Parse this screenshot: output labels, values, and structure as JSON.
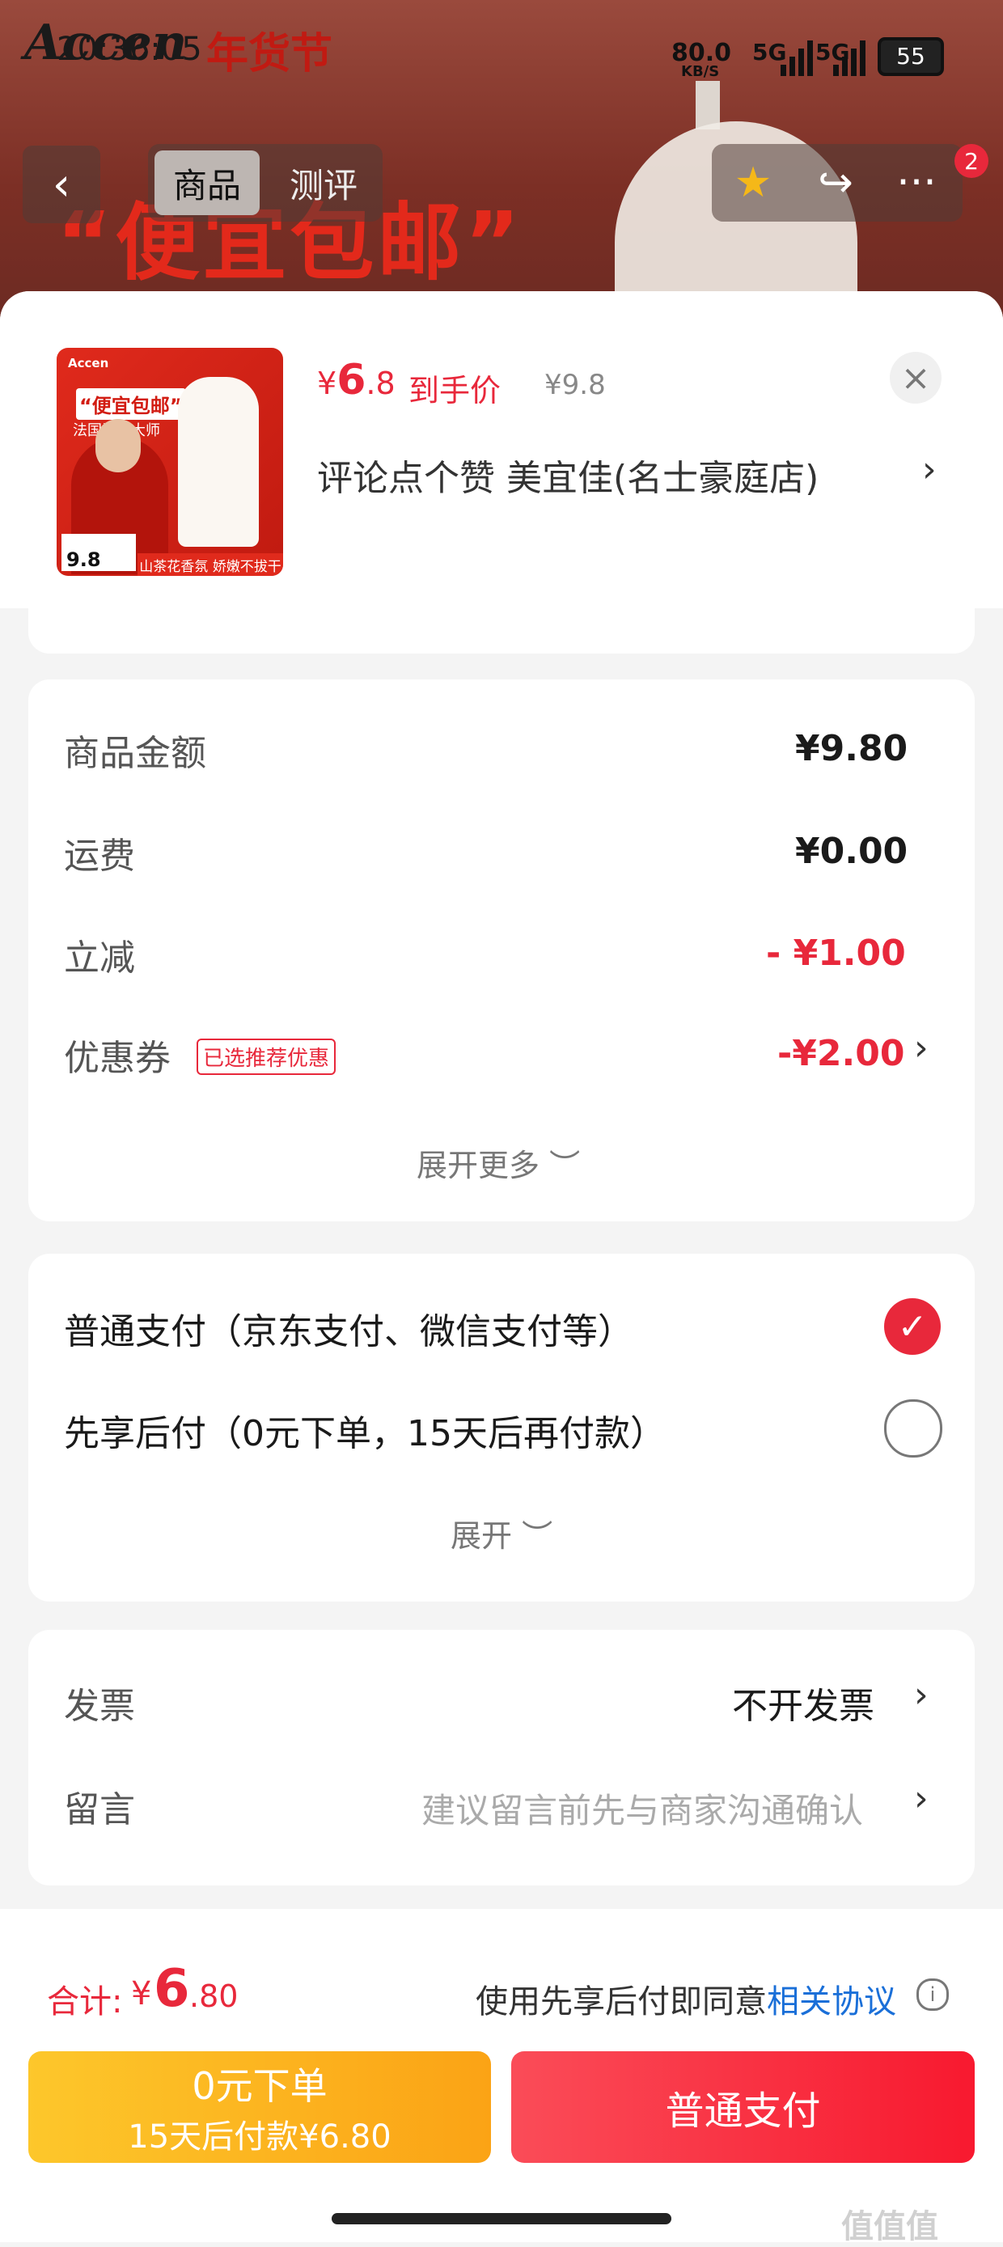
{
  "background": {
    "brand": "Accen",
    "festival": "年货节",
    "promo": "“便宜包邮”"
  },
  "status_bar": {
    "time": "20:36:05",
    "speed": "80.0",
    "speed_unit": "KB/S",
    "net1": "5G",
    "net2": "5G",
    "battery": "55"
  },
  "nav": {
    "back": "‹",
    "tab_goods": "商品",
    "tab_review": "测评",
    "badge_count": "2",
    "star": "★",
    "share": "↪",
    "more": "···"
  },
  "product": {
    "thumb_brand": "Accen",
    "thumb_slogan": "“便宜包邮”",
    "thumb_sub": "法国调香大师",
    "thumb_price": "9.8",
    "thumb_strip": "山茶花香氛 娇嫩不拔干",
    "deal_currency": "¥",
    "deal_int": "6",
    "deal_dec": ".8",
    "deal_label": "到手价",
    "orig_price": "¥9.8",
    "shop_line": "评论点个赞  美宜佳(名士豪庭店)",
    "close": "×"
  },
  "amount": {
    "goods_label": "商品金额",
    "goods_val": "¥9.80",
    "ship_label": "运费",
    "ship_val": "¥0.00",
    "discount_label": "立减",
    "discount_val": "- ¥1.00",
    "coupon_label": "优惠券",
    "coupon_tag": "已选推荐优惠",
    "coupon_val": "-¥2.00",
    "expand_more": "展开更多 ︶"
  },
  "payment": {
    "normal": "普通支付（京东支付、微信支付等）",
    "later": "先享后付（0元下单，15天后再付款）",
    "expand": "展开 ︶",
    "selected": "normal"
  },
  "invoice": {
    "label": "发票",
    "value": "不开发票",
    "msg_label": "留言",
    "msg_placeholder": "建议留言前先与商家沟通确认"
  },
  "bottom": {
    "total_label": "合计:",
    "total_sign": "¥",
    "total_int": "6",
    "total_dec": ".80",
    "agree_text": "使用先享后付即同意",
    "agree_link": "相关协议",
    "btn_later_1": "0元下单",
    "btn_later_2": "15天后付款¥6.80",
    "btn_normal": "普通支付"
  },
  "watermark": "值值值",
  "colors": {
    "accent": "#e8283b",
    "link": "#1a6fd8",
    "later_btn": "#fba315"
  }
}
